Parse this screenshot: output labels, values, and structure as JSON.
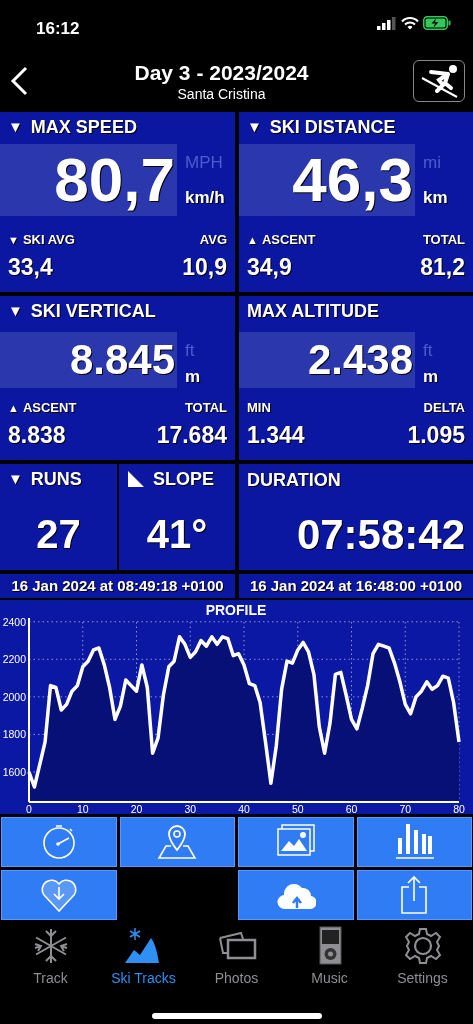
{
  "status_bar": {
    "time": "16:12"
  },
  "header": {
    "title": "Day 3 - 2023/2024",
    "subtitle": "Santa Cristina"
  },
  "tiles": [
    {
      "caret": "▼",
      "label": "MAX SPEED",
      "value": "80,7",
      "units": [
        {
          "label": "MPH",
          "selected": false
        },
        {
          "label": "km/h",
          "selected": true
        }
      ],
      "stats": [
        {
          "caret": "▼",
          "label": "SKI AVG",
          "value": "33,4"
        },
        {
          "label": "AVG",
          "value": "10,9"
        }
      ]
    },
    {
      "caret": "▼",
      "label": "SKI DISTANCE",
      "value": "46,3",
      "units": [
        {
          "label": "mi",
          "selected": false
        },
        {
          "label": "km",
          "selected": true
        }
      ],
      "stats": [
        {
          "caret": "▲",
          "label": "ASCENT",
          "value": "34,9"
        },
        {
          "label": "TOTAL",
          "value": "81,2"
        }
      ]
    },
    {
      "caret": "▼",
      "label": "SKI VERTICAL",
      "value": "8.845",
      "units": [
        {
          "label": "ft",
          "selected": false
        },
        {
          "label": "m",
          "selected": true
        }
      ],
      "stats": [
        {
          "caret": "▲",
          "label": "ASCENT",
          "value": "8.838"
        },
        {
          "label": "TOTAL",
          "value": "17.684"
        }
      ]
    },
    {
      "label": "MAX ALTITUDE",
      "value": "2.438",
      "units": [
        {
          "label": "ft",
          "selected": false
        },
        {
          "label": "m",
          "selected": true
        }
      ],
      "stats": [
        {
          "label": "MIN",
          "value": "1.344"
        },
        {
          "label": "DELTA",
          "value": "1.095"
        }
      ]
    }
  ],
  "small_tiles": [
    {
      "kind": "runs",
      "caret": "▼",
      "label": "RUNS",
      "value": "27"
    },
    {
      "kind": "slope",
      "label": "SLOPE",
      "value": "41°"
    }
  ],
  "duration": {
    "label": "DURATION",
    "value": "07:58:42"
  },
  "timestamps": [
    "16 Jan 2024 at 08:49:18 +0100",
    "16 Jan 2024 at 16:48:00 +0100"
  ],
  "profile": {
    "chart_data": {
      "type": "area",
      "title": "PROFILE",
      "x": [
        0,
        1,
        2,
        3,
        4,
        5,
        6,
        7,
        8,
        9,
        10,
        11,
        12,
        13,
        14,
        15,
        16,
        17,
        18,
        19,
        20,
        21,
        22,
        23,
        24,
        25,
        26,
        27,
        28,
        29,
        30,
        31,
        32,
        33,
        34,
        35,
        36,
        37,
        38,
        39,
        40,
        41,
        42,
        43,
        44,
        45,
        46,
        47,
        48,
        49,
        50,
        51,
        52,
        53,
        54,
        55,
        56,
        57,
        58,
        59,
        60,
        61,
        62,
        63,
        64,
        65,
        66,
        67,
        68,
        69,
        70,
        71,
        72,
        73,
        74,
        75,
        76,
        77,
        78,
        79,
        80
      ],
      "series": [
        {
          "color": "#ffffff",
          "values": [
            1600,
            1520,
            1640,
            1760,
            2060,
            2050,
            1930,
            1960,
            2030,
            2060,
            2160,
            2190,
            2250,
            2260,
            2170,
            2050,
            1880,
            1950,
            2090,
            2060,
            2030,
            2170,
            2050,
            1700,
            1780,
            2010,
            2160,
            2190,
            2320,
            2280,
            2210,
            2240,
            2300,
            2270,
            2320,
            2280,
            2320,
            2310,
            2220,
            2230,
            2170,
            2070,
            2060,
            1970,
            1760,
            1540,
            1740,
            2040,
            2190,
            2180,
            2250,
            2290,
            2240,
            2120,
            1840,
            1700,
            1860,
            2120,
            2130,
            2010,
            1880,
            1830,
            1940,
            2060,
            2230,
            2280,
            2270,
            2260,
            2180,
            2080,
            1960,
            1910,
            2000,
            2030,
            2080,
            2040,
            2060,
            2110,
            2100,
            1970,
            1760
          ]
        }
      ],
      "xlim": [
        0,
        80
      ],
      "ylim": [
        1440,
        2420
      ],
      "xticks": [
        0,
        10,
        20,
        30,
        40,
        50,
        60,
        70,
        80
      ],
      "yticks": [
        1600,
        1800,
        2000,
        2200,
        2400
      ],
      "grid": true
    }
  },
  "actions": [
    {
      "kind": "stopwatch"
    },
    {
      "kind": "map"
    },
    {
      "kind": "photos"
    },
    {
      "kind": "stats"
    },
    {
      "kind": "heart"
    },
    {
      "kind": "blank"
    },
    {
      "kind": "cloud"
    },
    {
      "kind": "share"
    }
  ],
  "tabs": [
    {
      "kind": "snowflake",
      "label": "Track",
      "selected": false
    },
    {
      "kind": "mountain",
      "label": "Ski Tracks",
      "selected": true
    },
    {
      "kind": "photos",
      "label": "Photos",
      "selected": false
    },
    {
      "kind": "music",
      "label": "Music",
      "selected": false
    },
    {
      "kind": "gear",
      "label": "Settings",
      "selected": false
    }
  ]
}
